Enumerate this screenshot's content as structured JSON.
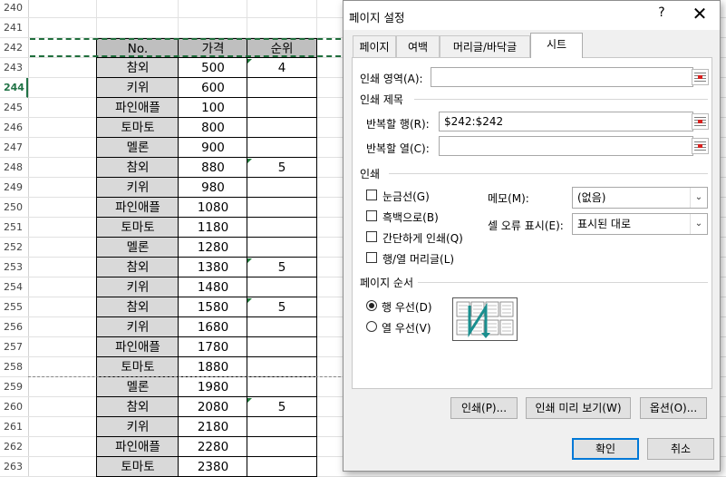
{
  "sheet": {
    "row_numbers": [
      240,
      241,
      242,
      243,
      244,
      245,
      246,
      247,
      248,
      249,
      250,
      251,
      252,
      253,
      254,
      255,
      256,
      257,
      258,
      259,
      260,
      261,
      262,
      263
    ],
    "selected_row": 244,
    "header": {
      "no": "No.",
      "price": "가격",
      "rank": "순위"
    },
    "rows": [
      {
        "name": "참외",
        "price": "500",
        "rank": "4",
        "flag": true
      },
      {
        "name": "키위",
        "price": "600",
        "rank": "",
        "flag": false
      },
      {
        "name": "파인애플",
        "price": "100",
        "rank": "",
        "flag": false
      },
      {
        "name": "토마토",
        "price": "800",
        "rank": "",
        "flag": false
      },
      {
        "name": "멜론",
        "price": "900",
        "rank": "",
        "flag": false
      },
      {
        "name": "참외",
        "price": "880",
        "rank": "5",
        "flag": true
      },
      {
        "name": "키위",
        "price": "980",
        "rank": "",
        "flag": false
      },
      {
        "name": "파인애플",
        "price": "1080",
        "rank": "",
        "flag": false
      },
      {
        "name": "토마토",
        "price": "1180",
        "rank": "",
        "flag": false
      },
      {
        "name": "멜론",
        "price": "1280",
        "rank": "",
        "flag": false
      },
      {
        "name": "참외",
        "price": "1380",
        "rank": "5",
        "flag": true
      },
      {
        "name": "키위",
        "price": "1480",
        "rank": "",
        "flag": false
      },
      {
        "name": "참외",
        "price": "1580",
        "rank": "5",
        "flag": true
      },
      {
        "name": "키위",
        "price": "1680",
        "rank": "",
        "flag": false
      },
      {
        "name": "파인애플",
        "price": "1780",
        "rank": "",
        "flag": false
      },
      {
        "name": "토마토",
        "price": "1880",
        "rank": "",
        "flag": false
      },
      {
        "name": "멜론",
        "price": "1980",
        "rank": "",
        "flag": false
      },
      {
        "name": "참외",
        "price": "2080",
        "rank": "5",
        "flag": true
      },
      {
        "name": "키위",
        "price": "2180",
        "rank": "",
        "flag": false
      },
      {
        "name": "파인애플",
        "price": "2280",
        "rank": "",
        "flag": false
      },
      {
        "name": "토마토",
        "price": "2380",
        "rank": "",
        "flag": false
      }
    ]
  },
  "dialog": {
    "title": "페이지 설정",
    "help": "?",
    "close": "✕",
    "tabs": [
      "페이지",
      "여백",
      "머리글/바닥글",
      "시트"
    ],
    "active_tab": "시트",
    "print_area_label": "인쇄 영역(A):",
    "print_area_value": "",
    "print_titles_label": "인쇄 제목",
    "rows_repeat_label": "반복할 행(R):",
    "rows_repeat_value": "$242:$242",
    "cols_repeat_label": "반복할 열(C):",
    "cols_repeat_value": "",
    "print_section": "인쇄",
    "checkboxes": [
      {
        "label": "눈금선(G)",
        "checked": false
      },
      {
        "label": "흑백으로(B)",
        "checked": false
      },
      {
        "label": "간단하게 인쇄(Q)",
        "checked": false
      },
      {
        "label": "행/열 머리글(L)",
        "checked": false
      }
    ],
    "comments_label": "메모(M):",
    "comments_value": "(없음)",
    "errors_label": "셀 오류 표시(E):",
    "errors_value": "표시된 대로",
    "page_order_label": "페이지 순서",
    "order_options": [
      {
        "label": "행 우선(D)",
        "selected": true
      },
      {
        "label": "열 우선(V)",
        "selected": false
      }
    ],
    "print_button": "인쇄(P)...",
    "preview_button": "인쇄 미리 보기(W)",
    "options_button": "옵션(O)...",
    "ok_button": "확인",
    "cancel_button": "취소"
  },
  "colors": {
    "accent_green": "#217346",
    "header_gray": "#bfbfbf",
    "data_gray": "#d9d9d9",
    "primary_blue": "#0078d7",
    "order_arrow": "#1a8f8f"
  }
}
